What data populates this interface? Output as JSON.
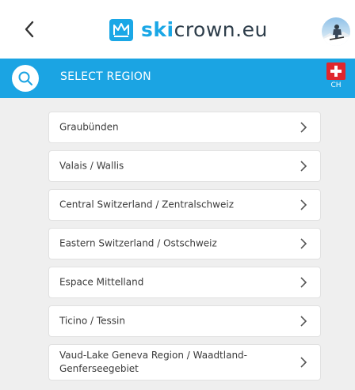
{
  "header": {
    "logo_prefix": "ski",
    "logo_suffix": "crown.eu"
  },
  "region_bar": {
    "title": "SELECT REGION",
    "country_code": "CH"
  },
  "regions": [
    {
      "label": "Graubünden"
    },
    {
      "label": "Valais / Wallis"
    },
    {
      "label": "Central Switzerland / Zentralschweiz"
    },
    {
      "label": "Eastern Switzerland / Ostschweiz"
    },
    {
      "label": "Espace Mittelland"
    },
    {
      "label": "Ticino / Tessin"
    },
    {
      "label": "Vaud-Lake Geneva Region / Waadtland-Genferseegebiet"
    }
  ],
  "colors": {
    "accent": "#1ba4e3",
    "logo_blue": "#1aa7e6",
    "logo_dark": "#2d3d4a",
    "background": "#efefef",
    "flag_red": "#e0272d"
  }
}
